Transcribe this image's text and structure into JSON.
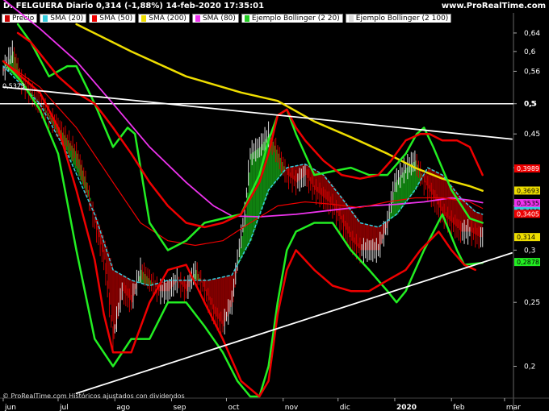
{
  "header": {
    "title": "D. FELGUERA Diario 0,314 (-1,88%) 14-feb-2020 17:35:01",
    "site": "www.ProRealTime.com"
  },
  "footer": {
    "copyright": "© ProRealTime.com Históricos ajustados con dividendos"
  },
  "legend": [
    {
      "label": "Precio",
      "color": "#cc0000"
    },
    {
      "label": "SMA (20)",
      "color": "#33ccdd"
    },
    {
      "label": "SMA (50)",
      "color": "#ee0000"
    },
    {
      "label": "SMA (200)",
      "color": "#eedd00"
    },
    {
      "label": "SMA (80)",
      "color": "#ee33ee"
    },
    {
      "label": "Ejemplo Bollinger (2 20)",
      "color": "#22cc22"
    },
    {
      "label": "Ejemplo Bollinger (2 100)",
      "color": "#dddddd"
    }
  ],
  "chart_data": {
    "type": "line",
    "scale": "log",
    "ylim": [
      0.18,
      0.66
    ],
    "yticks": [
      0.2,
      0.25,
      0.3,
      0.35,
      0.4,
      0.45,
      0.5,
      0.56,
      0.6,
      0.64
    ],
    "ytick_labels": [
      "0,2",
      "0,25",
      "0,3",
      "0,35",
      "0,4",
      "0,45",
      "0,5",
      "0,56",
      "0,6",
      "0,64"
    ],
    "xticks": [
      {
        "label": "jun",
        "day": 0
      },
      {
        "label": "jul",
        "day": 30
      },
      {
        "label": "ago",
        "day": 61
      },
      {
        "label": "sep",
        "day": 92
      },
      {
        "label": "oct",
        "day": 122
      },
      {
        "label": "nov",
        "day": 153
      },
      {
        "label": "dic",
        "day": 183
      },
      {
        "label": "2020",
        "day": 214
      },
      {
        "label": "feb",
        "day": 245
      },
      {
        "label": "mar",
        "day": 274
      }
    ],
    "xlim": [
      0,
      278
    ],
    "series": [
      {
        "name": "SMA (200)",
        "color": "#eedd00",
        "width": 2.5,
        "points": [
          [
            40,
            0.66
          ],
          [
            70,
            0.6
          ],
          [
            100,
            0.55
          ],
          [
            130,
            0.52
          ],
          [
            150,
            0.505
          ],
          [
            170,
            0.47
          ],
          [
            190,
            0.445
          ],
          [
            210,
            0.42
          ],
          [
            225,
            0.4
          ],
          [
            240,
            0.385
          ],
          [
            255,
            0.375
          ],
          [
            262,
            0.369
          ]
        ]
      },
      {
        "name": "SMA (80)",
        "color": "#ee33ee",
        "width": 1.8,
        "points": [
          [
            0,
            0.72
          ],
          [
            20,
            0.65
          ],
          [
            40,
            0.58
          ],
          [
            60,
            0.5
          ],
          [
            80,
            0.43
          ],
          [
            100,
            0.38
          ],
          [
            115,
            0.35
          ],
          [
            125,
            0.338
          ],
          [
            140,
            0.337
          ],
          [
            160,
            0.34
          ],
          [
            180,
            0.345
          ],
          [
            200,
            0.35
          ],
          [
            215,
            0.352
          ],
          [
            230,
            0.355
          ],
          [
            245,
            0.36
          ],
          [
            255,
            0.357
          ],
          [
            262,
            0.354
          ]
        ]
      },
      {
        "name": "SMA (50)",
        "color": "#ee0000",
        "width": 1.2,
        "points": [
          [
            0,
            0.58
          ],
          [
            20,
            0.53
          ],
          [
            40,
            0.46
          ],
          [
            60,
            0.38
          ],
          [
            75,
            0.33
          ],
          [
            90,
            0.31
          ],
          [
            105,
            0.305
          ],
          [
            120,
            0.31
          ],
          [
            135,
            0.33
          ],
          [
            150,
            0.35
          ],
          [
            165,
            0.355
          ],
          [
            180,
            0.352
          ],
          [
            195,
            0.348
          ],
          [
            210,
            0.355
          ],
          [
            225,
            0.36
          ],
          [
            240,
            0.36
          ],
          [
            255,
            0.355
          ],
          [
            262,
            0.347
          ]
        ]
      },
      {
        "name": "SMA (20)",
        "color": "#33ccdd",
        "width": 1.5,
        "dash": "3,3",
        "points": [
          [
            0,
            0.57
          ],
          [
            20,
            0.5
          ],
          [
            35,
            0.42
          ],
          [
            50,
            0.34
          ],
          [
            60,
            0.28
          ],
          [
            70,
            0.27
          ],
          [
            80,
            0.265
          ],
          [
            90,
            0.27
          ],
          [
            100,
            0.27
          ],
          [
            112,
            0.27
          ],
          [
            125,
            0.275
          ],
          [
            135,
            0.31
          ],
          [
            145,
            0.37
          ],
          [
            155,
            0.4
          ],
          [
            165,
            0.405
          ],
          [
            175,
            0.39
          ],
          [
            185,
            0.36
          ],
          [
            195,
            0.33
          ],
          [
            205,
            0.325
          ],
          [
            215,
            0.34
          ],
          [
            225,
            0.37
          ],
          [
            232,
            0.4
          ],
          [
            240,
            0.39
          ],
          [
            250,
            0.36
          ],
          [
            258,
            0.343
          ],
          [
            262,
            0.34
          ]
        ]
      },
      {
        "name": "Ejemplo Bollinger (2 20) upper",
        "color": "#22ee22",
        "width": 2.5,
        "points": [
          [
            8,
            0.66
          ],
          [
            15,
            0.62
          ],
          [
            25,
            0.55
          ],
          [
            35,
            0.57
          ],
          [
            40,
            0.57
          ],
          [
            50,
            0.5
          ],
          [
            60,
            0.43
          ],
          [
            68,
            0.46
          ],
          [
            72,
            0.45
          ],
          [
            80,
            0.33
          ],
          [
            90,
            0.3
          ],
          [
            100,
            0.31
          ],
          [
            110,
            0.33
          ],
          [
            120,
            0.335
          ],
          [
            130,
            0.34
          ],
          [
            140,
            0.39
          ],
          [
            145,
            0.44
          ],
          [
            150,
            0.48
          ],
          [
            155,
            0.49
          ],
          [
            160,
            0.45
          ],
          [
            170,
            0.39
          ],
          [
            180,
            0.395
          ],
          [
            190,
            0.4
          ],
          [
            200,
            0.39
          ],
          [
            210,
            0.39
          ],
          [
            220,
            0.42
          ],
          [
            226,
            0.45
          ],
          [
            230,
            0.46
          ],
          [
            235,
            0.43
          ],
          [
            245,
            0.37
          ],
          [
            255,
            0.335
          ],
          [
            262,
            0.33
          ]
        ]
      },
      {
        "name": "Ejemplo Bollinger (2 20) lower",
        "color": "#22ee22",
        "width": 2.5,
        "points": [
          [
            0,
            0.58
          ],
          [
            10,
            0.54
          ],
          [
            20,
            0.49
          ],
          [
            30,
            0.42
          ],
          [
            40,
            0.3
          ],
          [
            50,
            0.22
          ],
          [
            60,
            0.2
          ],
          [
            70,
            0.22
          ],
          [
            80,
            0.22
          ],
          [
            90,
            0.25
          ],
          [
            100,
            0.25
          ],
          [
            110,
            0.23
          ],
          [
            120,
            0.21
          ],
          [
            128,
            0.19
          ],
          [
            135,
            0.18
          ],
          [
            140,
            0.18
          ],
          [
            145,
            0.2
          ],
          [
            150,
            0.25
          ],
          [
            155,
            0.3
          ],
          [
            160,
            0.32
          ],
          [
            170,
            0.33
          ],
          [
            180,
            0.33
          ],
          [
            190,
            0.3
          ],
          [
            200,
            0.28
          ],
          [
            210,
            0.26
          ],
          [
            215,
            0.25
          ],
          [
            220,
            0.26
          ],
          [
            230,
            0.3
          ],
          [
            240,
            0.34
          ],
          [
            248,
            0.3
          ],
          [
            252,
            0.285
          ],
          [
            262,
            0.287
          ]
        ]
      },
      {
        "name": "Ejemplo Bollinger (2 100) upper",
        "color": "#ee0000",
        "width": 2.5,
        "points": [
          [
            8,
            0.64
          ],
          [
            15,
            0.62
          ],
          [
            30,
            0.55
          ],
          [
            40,
            0.52
          ],
          [
            50,
            0.5
          ],
          [
            55,
            0.48
          ],
          [
            60,
            0.46
          ],
          [
            70,
            0.42
          ],
          [
            80,
            0.38
          ],
          [
            90,
            0.35
          ],
          [
            100,
            0.33
          ],
          [
            110,
            0.325
          ],
          [
            120,
            0.33
          ],
          [
            130,
            0.34
          ],
          [
            140,
            0.38
          ],
          [
            145,
            0.42
          ],
          [
            150,
            0.48
          ],
          [
            155,
            0.49
          ],
          [
            160,
            0.46
          ],
          [
            165,
            0.44
          ],
          [
            175,
            0.41
          ],
          [
            185,
            0.39
          ],
          [
            195,
            0.385
          ],
          [
            205,
            0.39
          ],
          [
            212,
            0.41
          ],
          [
            220,
            0.44
          ],
          [
            228,
            0.45
          ],
          [
            233,
            0.45
          ],
          [
            240,
            0.44
          ],
          [
            248,
            0.44
          ],
          [
            255,
            0.43
          ],
          [
            262,
            0.39
          ]
        ]
      },
      {
        "name": "Ejemplo Bollinger (2 100) lower",
        "color": "#ee0000",
        "width": 2.5,
        "points": [
          [
            0,
            0.58
          ],
          [
            20,
            0.52
          ],
          [
            30,
            0.46
          ],
          [
            40,
            0.37
          ],
          [
            50,
            0.29
          ],
          [
            55,
            0.24
          ],
          [
            60,
            0.21
          ],
          [
            70,
            0.21
          ],
          [
            80,
            0.25
          ],
          [
            90,
            0.28
          ],
          [
            100,
            0.285
          ],
          [
            110,
            0.25
          ],
          [
            120,
            0.22
          ],
          [
            130,
            0.19
          ],
          [
            140,
            0.18
          ],
          [
            145,
            0.19
          ],
          [
            150,
            0.24
          ],
          [
            155,
            0.28
          ],
          [
            160,
            0.3
          ],
          [
            170,
            0.28
          ],
          [
            180,
            0.265
          ],
          [
            190,
            0.26
          ],
          [
            200,
            0.26
          ],
          [
            210,
            0.27
          ],
          [
            220,
            0.28
          ],
          [
            228,
            0.3
          ],
          [
            238,
            0.32
          ],
          [
            245,
            0.3
          ],
          [
            252,
            0.285
          ],
          [
            258,
            0.28
          ]
        ]
      },
      {
        "name": "Ejemplo Bollinger (2 100) trend top",
        "color": "#ffffff",
        "width": 1.8,
        "points": [
          [
            0,
            0.53
          ],
          [
            278,
            0.442
          ]
        ]
      },
      {
        "name": "Ejemplo Bollinger (2 100) trend bottom",
        "color": "#ffffff",
        "width": 1.8,
        "points": [
          [
            40,
            0.182
          ],
          [
            278,
            0.297
          ]
        ]
      }
    ],
    "price": {
      "color_up": "#dddddd",
      "color_down": "#cc0000",
      "fill_between_colors": {
        "up": "#118811",
        "down": "#880000"
      },
      "points": [
        [
          0,
          0.56
        ],
        [
          5,
          0.6
        ],
        [
          10,
          0.54
        ],
        [
          20,
          0.5
        ],
        [
          30,
          0.46
        ],
        [
          40,
          0.42
        ],
        [
          45,
          0.38
        ],
        [
          50,
          0.33
        ],
        [
          55,
          0.29
        ],
        [
          60,
          0.22
        ],
        [
          65,
          0.26
        ],
        [
          70,
          0.25
        ],
        [
          75,
          0.28
        ],
        [
          80,
          0.27
        ],
        [
          85,
          0.26
        ],
        [
          90,
          0.26
        ],
        [
          95,
          0.27
        ],
        [
          100,
          0.26
        ],
        [
          105,
          0.28
        ],
        [
          110,
          0.26
        ],
        [
          115,
          0.24
        ],
        [
          120,
          0.23
        ],
        [
          125,
          0.25
        ],
        [
          128,
          0.29
        ],
        [
          132,
          0.34
        ],
        [
          135,
          0.42
        ],
        [
          140,
          0.43
        ],
        [
          145,
          0.45
        ],
        [
          150,
          0.42
        ],
        [
          155,
          0.39
        ],
        [
          160,
          0.38
        ],
        [
          165,
          0.39
        ],
        [
          170,
          0.37
        ],
        [
          175,
          0.36
        ],
        [
          180,
          0.35
        ],
        [
          185,
          0.33
        ],
        [
          190,
          0.31
        ],
        [
          195,
          0.3
        ],
        [
          200,
          0.3
        ],
        [
          205,
          0.3
        ],
        [
          210,
          0.33
        ],
        [
          214,
          0.38
        ],
        [
          220,
          0.4
        ],
        [
          225,
          0.41
        ],
        [
          230,
          0.38
        ],
        [
          235,
          0.36
        ],
        [
          240,
          0.34
        ],
        [
          245,
          0.33
        ],
        [
          250,
          0.32
        ],
        [
          255,
          0.32
        ],
        [
          260,
          0.314
        ],
        [
          262,
          0.314
        ]
      ]
    },
    "hline": {
      "value": 0.5,
      "color": "#ffffff",
      "label": "0,5"
    },
    "level_marker": {
      "value": 0.5323,
      "label": "0,5323"
    },
    "price_tags": [
      {
        "value": 0.3989,
        "label": "0,3989",
        "bg": "#ee0000",
        "fg": "#ffffff"
      },
      {
        "value": 0.3693,
        "label": "0,3693",
        "bg": "#eedd00",
        "fg": "#000000"
      },
      {
        "value": 0.3535,
        "label": "0,3535",
        "bg": "#ee33ee",
        "fg": "#000000"
      },
      {
        "value": 0.3439,
        "label": "0,3439",
        "bg": "#33ccdd",
        "fg": "#000000"
      },
      {
        "value": 0.3405,
        "label": "0,3405",
        "bg": "#ee0000",
        "fg": "#ffffff"
      },
      {
        "value": 0.314,
        "label": "0,314",
        "bg": "#eedd00",
        "fg": "#000000"
      },
      {
        "value": 0.2878,
        "label": "0,2878",
        "bg": "#22ee22",
        "fg": "#000000"
      }
    ]
  }
}
